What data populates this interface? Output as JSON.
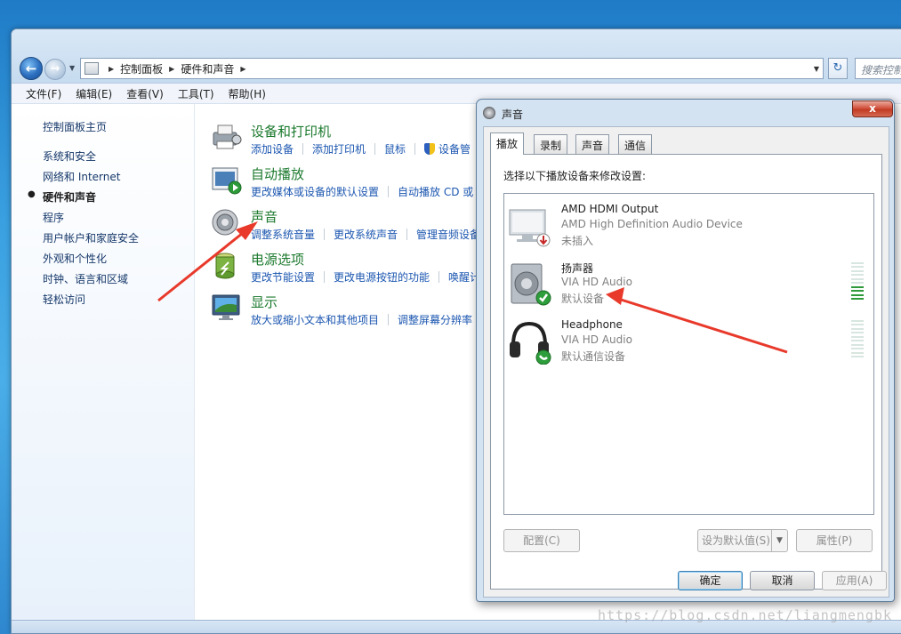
{
  "explorer": {
    "breadcrumb": [
      "控制面板",
      "硬件和声音"
    ],
    "search_placeholder": "搜索控制",
    "menu": [
      "文件(F)",
      "编辑(E)",
      "查看(V)",
      "工具(T)",
      "帮助(H)"
    ]
  },
  "sidebar": {
    "home": "控制面板主页",
    "items": [
      {
        "label": "系统和安全"
      },
      {
        "label": "网络和 Internet"
      },
      {
        "label": "硬件和声音",
        "active": true
      },
      {
        "label": "程序"
      },
      {
        "label": "用户帐户和家庭安全"
      },
      {
        "label": "外观和个性化"
      },
      {
        "label": "时钟、语言和区域"
      },
      {
        "label": "轻松访问"
      }
    ]
  },
  "categories": [
    {
      "title": "设备和打印机",
      "icon": "printer-icon",
      "links": [
        "添加设备",
        "添加打印机",
        "鼠标",
        "设备管"
      ]
    },
    {
      "title": "自动播放",
      "icon": "autoplay-icon",
      "links": [
        "更改媒体或设备的默认设置",
        "自动播放 CD 或"
      ]
    },
    {
      "title": "声音",
      "icon": "speaker-icon",
      "links": [
        "调整系统音量",
        "更改系统声音",
        "管理音频设备"
      ]
    },
    {
      "title": "电源选项",
      "icon": "battery-icon",
      "links": [
        "更改节能设置",
        "更改电源按钮的功能",
        "唤醒计"
      ]
    },
    {
      "title": "显示",
      "icon": "monitor-icon",
      "links": [
        "放大或缩小文本和其他项目",
        "调整屏幕分辨率"
      ]
    }
  ],
  "dialog": {
    "title": "声音",
    "close": "x",
    "tabs": [
      "播放",
      "录制",
      "声音",
      "通信"
    ],
    "instruction": "选择以下播放设备来修改设置:",
    "devices": [
      {
        "name": "AMD HDMI Output",
        "driver": "AMD High Definition Audio Device",
        "status": "未插入",
        "icon": "hdmi-monitor-icon",
        "badge": "unplugged-badge-icon"
      },
      {
        "name": "扬声器",
        "driver": "VIA HD Audio",
        "status": "默认设备",
        "icon": "speaker-device-icon",
        "badge": "default-check-icon",
        "level": 0.35
      },
      {
        "name": "Headphone",
        "driver": "VIA HD Audio",
        "status": "默认通信设备",
        "icon": "headphone-icon",
        "badge": "communication-phone-icon",
        "level": 0
      }
    ],
    "buttons": {
      "configure": "配置(C)",
      "set_default": "设为默认值(S)",
      "properties": "属性(P)",
      "ok": "确定",
      "cancel": "取消",
      "apply": "应用(A)"
    }
  },
  "watermark": "https://blog.csdn.net/liangmengbk",
  "colors": {
    "annotation_arrow": "#e8392b",
    "category_title": "#1c7a2e",
    "link": "#1b56b0"
  }
}
